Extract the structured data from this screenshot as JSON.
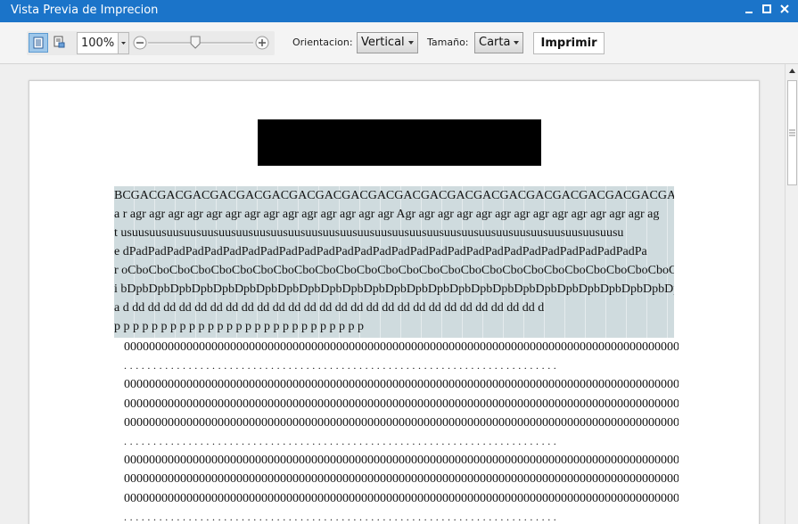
{
  "window": {
    "title": "Vista Previa de Imprecion"
  },
  "toolbar": {
    "zoom_value": "100%",
    "zoom_slider_fraction": 0.45,
    "orientation_label": "Orientacion:",
    "orientation_value": "Vertical",
    "size_label": "Tamaño:",
    "size_value": "Carta",
    "print_label": "Imprimir"
  },
  "document": {
    "header_rows": [
      "BCGACGACGACGACGACGACGACGACGACGACGACGACGACGACGACGACGACGACGACGACGACGACGACGACGACGA",
      "a r agr agr agr agr agr agr agr agr agr agr agr agr agr agr Agr agr agr agr agr agr agr agr agr agr agr agr agr ag",
      "t usuusuusuusuusuusuusuusuusuusuusuusuusuusuusuusuusuusuusuusuusuusuusuusuusuusuusuusuusu",
      "e dPadPadPadPadPadPadPadPadPadPadPadPadPadPadPadPadPadPadPadPadPadPadPadPadPadPadPadPa",
      "r oCboCboCboCboCboCboCboCboCboCboCboCboCboCboCboCboCboCboCboCboCboCboCboCboCboCboCboCb",
      "i bDpbDpbDpbDpbDpbDpbDpbDpbDpbDpbDpbDpbDpbDpbDpbDpbDpbDpbDpbDpbDpbDpbDpbDpbDpbDpbDp",
      "a d  dd   dd   dd   dd   dd   dd   dd   dd   dd   dd   dd   dd   dd   dd   dd   dd   dd   dd   dd   dd   dd   dd   dd   dd   dd   dd   d",
      "  p     p     p     p     p     p     p     p     p     p     p     p     p     p     p     p     p     p     p     p     p     p     p     p     p     p     p"
    ],
    "data_rows": [
      "0000000000000000000000000000000000000000000000000000000000000000000000000000000000000000000000",
      "..........................................................................",
      "0000000000000000000000000000000000000000000000000000000000000000000000000000000000000000000000",
      "0000000000000000000000000000000000000000000000000000000000000000000000000000000000000000000000",
      "0000000000000000000000000000000000000000000000000000000000000000000000000000000000000000000000",
      "..........................................................................",
      "0000000000000000000000000000000000000000000000000000000000000000000000000000000000000000000000",
      "0000000000000000000000000000000000000000000000000000000000000000000000000000000000000000000000",
      "0000000000000000000000000000000000000000000000000000000000000000000000000000000000000000000000",
      ".........................................................................."
    ]
  }
}
